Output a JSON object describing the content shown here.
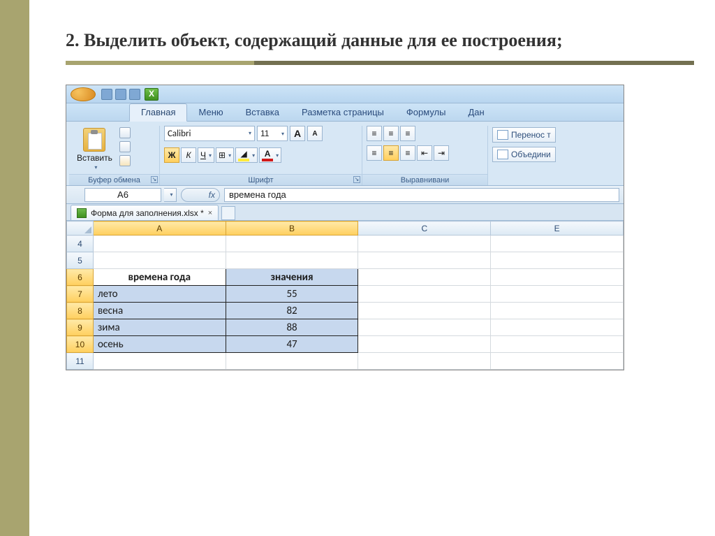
{
  "slide": {
    "title": "2. Выделить объект, содержащий данные для ее построения;"
  },
  "ribbon": {
    "tabs": [
      "Главная",
      "Меню",
      "Вставка",
      "Разметка страницы",
      "Формулы",
      "Дан"
    ],
    "active_tab": 0,
    "paste_label": "Вставить",
    "group_clipboard": "Буфер обмена",
    "group_font": "Шрифт",
    "group_align": "Выравнивани",
    "font_name": "Calibri",
    "font_size": "11",
    "bold": "Ж",
    "italic": "К",
    "underline": "Ч",
    "wrap_text": "Перенос т",
    "merge_text": "Объедини"
  },
  "formula_bar": {
    "cell_ref": "A6",
    "fx": "fx",
    "value": "времена года"
  },
  "doc": {
    "filename": "Форма для заполнения.xlsx *"
  },
  "grid": {
    "columns": [
      "A",
      "B",
      "C",
      "E"
    ],
    "rows": [
      "4",
      "5",
      "6",
      "7",
      "8",
      "9",
      "10",
      "11"
    ],
    "table_header_a": "времена года",
    "table_header_b": "значения",
    "data": [
      {
        "a": "лето",
        "b": "55"
      },
      {
        "a": "весна",
        "b": "82"
      },
      {
        "a": "зима",
        "b": "88"
      },
      {
        "a": "осень",
        "b": "47"
      }
    ]
  },
  "chart_data": {
    "type": "table",
    "title": "времена года / значения",
    "categories": [
      "лето",
      "весна",
      "зима",
      "осень"
    ],
    "values": [
      55,
      82,
      88,
      47
    ]
  }
}
